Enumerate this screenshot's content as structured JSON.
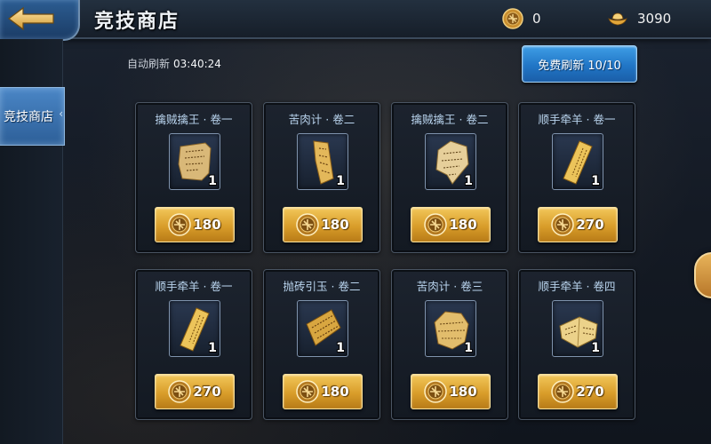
{
  "header": {
    "title": "竞技商店"
  },
  "currencies": {
    "medal": {
      "amount": "0",
      "icon": "arena-medal-icon"
    },
    "gold": {
      "amount": "3090",
      "icon": "gold-ingot-icon"
    }
  },
  "sidebar": {
    "tabs": [
      {
        "label": "竞技商店",
        "selected": true
      }
    ]
  },
  "refresh": {
    "auto_label": "自动刷新",
    "countdown": "03:40:24",
    "button_label": "免费刷新 10/10"
  },
  "items": [
    {
      "name": "擒贼擒王 · 卷一",
      "qty": "1",
      "price": "180",
      "scroll": "tattered"
    },
    {
      "name": "苦肉计 · 卷二",
      "qty": "1",
      "price": "180",
      "scroll": "strip"
    },
    {
      "name": "擒贼擒王 · 卷二",
      "qty": "1",
      "price": "180",
      "scroll": "torn"
    },
    {
      "name": "顺手牵羊 · 卷一",
      "qty": "1",
      "price": "270",
      "scroll": "slip"
    },
    {
      "name": "顺手牵羊 · 卷一",
      "qty": "1",
      "price": "270",
      "scroll": "slip"
    },
    {
      "name": "抛砖引玉 · 卷二",
      "qty": "1",
      "price": "180",
      "scroll": "bamboo"
    },
    {
      "name": "苦肉计 · 卷三",
      "qty": "1",
      "price": "180",
      "scroll": "crumpled"
    },
    {
      "name": "顺手牵羊 · 卷四",
      "qty": "1",
      "price": "270",
      "scroll": "folded"
    }
  ],
  "colors": {
    "item_name": "#b9d4ee",
    "buy_button": "#d99d2a",
    "refresh_button": "#2176c6",
    "selected_tab": "#3a74b2"
  }
}
